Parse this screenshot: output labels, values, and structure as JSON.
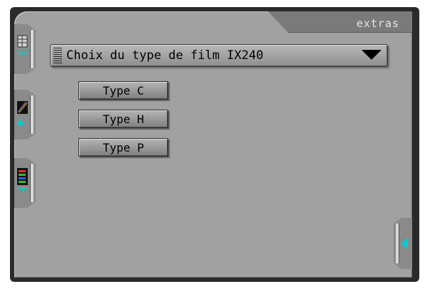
{
  "header": {
    "tab_label": "extras"
  },
  "film_selector": {
    "label": "Choix du type de film IX240"
  },
  "buttons": [
    {
      "label": "Type C"
    },
    {
      "label": "Type H"
    },
    {
      "label": "Type P"
    }
  ],
  "icons": {
    "side_tab_1": "film-frame-icon",
    "side_tab_2": "color-histogram-icon",
    "side_tab_3": "color-levels-icon",
    "right_tab": "collapse-left-arrow-icon"
  },
  "colors": {
    "accent_cyan": "#10c8c8",
    "panel_gray": "#a1a1a1"
  }
}
